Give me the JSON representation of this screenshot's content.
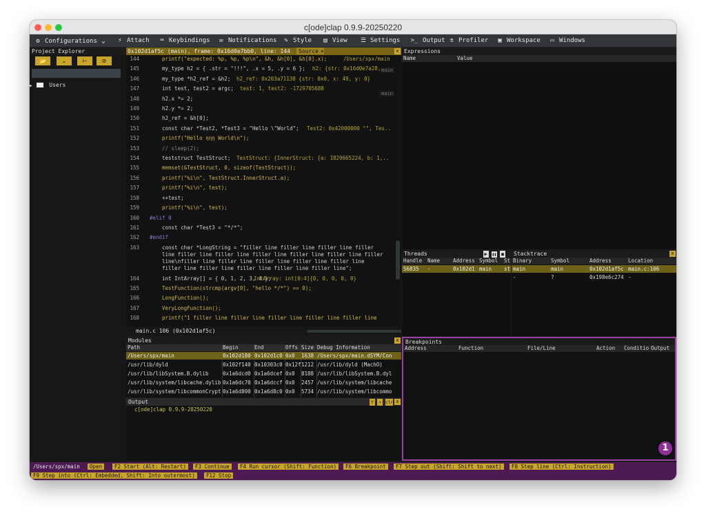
{
  "window": {
    "title": "c[ode]clap 0.9.9-20250220"
  },
  "menu": [
    {
      "label": "Configurations",
      "icon": "gear-icon",
      "glyph": "⚙",
      "dropdown": "⌄"
    },
    {
      "label": "Attach",
      "icon": "plug-icon",
      "glyph": "⚡"
    },
    {
      "label": "Keybindings",
      "icon": "keyboard-icon",
      "glyph": "⌨"
    },
    {
      "label": "Notifications",
      "icon": "chat-icon",
      "glyph": "✉"
    },
    {
      "label": "Style",
      "icon": "pen-icon",
      "glyph": "✎"
    },
    {
      "label": "View",
      "icon": "view-icon",
      "glyph": "▤"
    },
    {
      "label": "Settings",
      "icon": "sliders-icon",
      "glyph": "☰"
    },
    {
      "label": "Output",
      "icon": "terminal-icon",
      "glyph": ">_"
    },
    {
      "label": "Profiler",
      "icon": "flask-icon",
      "glyph": "⚗"
    },
    {
      "label": "Workspace",
      "icon": "workspace-icon",
      "glyph": "▣"
    },
    {
      "label": "Windows",
      "icon": "windows-icon",
      "glyph": "▭"
    }
  ],
  "project_explorer": {
    "title": "Project Explorer",
    "tree_item": "Users",
    "folder_glyph": "▶",
    "buttons": [
      {
        "icon": "open-folder-icon",
        "glyph": "📂"
      },
      {
        "icon": "chevron-down-icon",
        "glyph": "⌄"
      },
      {
        "icon": "tree-icon",
        "glyph": "⊢"
      },
      {
        "icon": "hide-icon",
        "glyph": "⊘"
      }
    ]
  },
  "source": {
    "header": "0x102d1af5c (main), frame: 0x16d0e7bb0, line: 144",
    "dropdown": "Source",
    "dropdown_arrow": "▾",
    "status": "main.c  106 (0x102d1af5c)",
    "lines": [
      {
        "n": "144",
        "code": "printf(\"expected: %p, %p, %p\\n\", &h, &h[0], &h[0].x);",
        "ann": "/Users/spx/main",
        "annx": 315
      },
      {
        "n": "145",
        "code": "my_type h2 = { .str = \"!!!\", .x = 5, .y = 6 };",
        "ann": "h2: {str: 0x16d0e7a28, ..",
        "annx": 270
      },
      {
        "n": "146",
        "code": "my_type *h2_ref = &h2;",
        "ann": "h2_ref: 0x203a71138 {str: 0x0, x: 49, y: 0}",
        "annx": 160
      },
      {
        "n": "147",
        "code": "int test, test2 = argc;",
        "ann": "test: 1, test2: -1729705688",
        "annx": 165
      },
      {
        "n": "148",
        "code": "h2.x *= 2;",
        "ann": "",
        "annx": 0
      },
      {
        "n": "149",
        "code": "h2.y *= 2;",
        "ann": "",
        "annx": 0
      },
      {
        "n": "150",
        "code": "h2_ref = &h[0];",
        "ann": "",
        "annx": 0
      },
      {
        "n": "151",
        "code": "const char *Test2, *Test3 = \"Hello \\\"World\";",
        "ann": "Test2: 0x42000000 \"\", Tes..",
        "annx": 262
      },
      {
        "n": "152",
        "code": "printf(\"Hello ηηη World\\n\");",
        "ann": "",
        "annx": 0
      },
      {
        "n": "153",
        "code": "// sleep(2);",
        "ann": "",
        "annx": 0
      },
      {
        "n": "154",
        "code": "teststruct TestStruct;",
        "ann": "TestStruct: {InnerStruct: {a: 1829665224, b: 1,..",
        "annx": 160
      },
      {
        "n": "155",
        "code": "memset(&TestStruct, 0, sizeof(TestStruct));",
        "ann": "",
        "annx": 0
      },
      {
        "n": "156",
        "code": "printf(\"%i\\n\", TestStruct.InnerStruct.a);",
        "ann": "",
        "annx": 0
      },
      {
        "n": "157",
        "code": "printf(\"%i\\n\", test);",
        "ann": "",
        "annx": 0
      },
      {
        "n": "158",
        "code": "++test;",
        "ann": "",
        "annx": 0
      },
      {
        "n": "159",
        "code": "printf(\"%i\\n\", test);",
        "ann": "",
        "annx": 0
      },
      {
        "n": "160",
        "code": "#elif 0",
        "ann": "",
        "annx": 0
      },
      {
        "n": "161",
        "code": "const char *Test3 = \"*/*\";",
        "ann": "",
        "annx": 0
      },
      {
        "n": "162",
        "code": "#endif",
        "ann": "",
        "annx": 0
      },
      {
        "n": "163",
        "code": "const char *LongString = \"filler line filler line filler line filler",
        "ann": "",
        "annx": 0
      },
      {
        "n": "",
        "code": "line filler line filler line filler line filler line filler line filler",
        "ann": "",
        "annx": 0
      },
      {
        "n": "",
        "code": "line\\nfiller line filler line filler line filler line filler line",
        "ann": "",
        "annx": 0
      },
      {
        "n": "",
        "code": "filler line filler line filler line filler line filler line\";",
        "ann": "",
        "annx": 0
      },
      {
        "n": "164",
        "code": "int IntArray[] = { 0, 1, 2, 3, 4 };",
        "ann": "IntArray: int[0:4]{0, 0, 0, 0, 0}",
        "annx": 185
      },
      {
        "n": "165",
        "code": "TestFunction(strcmp(argv[0], \"hello */*\") == 0);",
        "ann": "",
        "annx": 0
      },
      {
        "n": "166",
        "code": "LongFunction();",
        "ann": "",
        "annx": 0
      },
      {
        "n": "167",
        "code": "VeryLongFunction();",
        "ann": "",
        "annx": 0
      },
      {
        "n": "168",
        "code": "printf(\"1  filler line filler line filler line filler line filler line",
        "ann": "",
        "annx": 0
      }
    ],
    "side_tags": [
      {
        "text": "main",
        "y": 18
      },
      {
        "text": "main",
        "y": 52
      }
    ]
  },
  "expressions": {
    "title": "Expressions",
    "cols": [
      "Name",
      "Value"
    ]
  },
  "threads": {
    "title": "Threads",
    "cols": [
      "Handle",
      "Name",
      "Address",
      "Symbol",
      "St"
    ],
    "rows": [
      [
        "56835",
        "-",
        "0x102d1",
        "main",
        "st"
      ]
    ],
    "controls": [
      "▶",
      "❚❚",
      "■"
    ]
  },
  "stacktrace": {
    "title": "Stacktrace",
    "cols": [
      "Binary",
      "Symbol",
      "Address",
      "Location"
    ],
    "rows": [
      [
        "main",
        "main",
        "0x102d1af5c",
        "main.c:106"
      ],
      [
        "-",
        "?",
        "0x198e6c274",
        "-"
      ]
    ]
  },
  "modules": {
    "title": "Modules",
    "cols": [
      "Path",
      "Begin",
      "End",
      "Offs",
      "Size",
      "Debug Information"
    ],
    "rows": [
      [
        "/Users/spx/main",
        "0x102d180",
        "0x102d1c0",
        "0x0",
        "1638",
        "/Users/spx/main.dSYM/Con"
      ],
      [
        "/usr/lib/dyld",
        "0x102f140",
        "0x10303c0",
        "0x12f",
        "1212",
        "/usr/lib/dyld (MachO)"
      ],
      [
        "/usr/lib/libSystem.B.dylib",
        "0x1a6dcd0",
        "0x1a6dcef",
        "0x0",
        "8188",
        "/usr/lib/libSystem.B.dyl"
      ],
      [
        "/usr/lib/system/libcache.dylib",
        "0x1a6dc70",
        "0x1a6dccf",
        "0x0",
        "2457",
        "/usr/lib/system/libcache"
      ],
      [
        "/usr/lib/system/libcommonCrypt",
        "0x1a6d800",
        "0x1a6d8c0",
        "0x0",
        "5734",
        "/usr/lib/system/libcommo"
      ]
    ]
  },
  "output": {
    "title": "Output",
    "line": "c[ode]clap 0.9.9-20250220",
    "controls": [
      "Y",
      "▾",
      "clr"
    ]
  },
  "breakpoints": {
    "title": "Breakpoints",
    "cols": [
      "Address",
      "Function",
      "File/Line",
      "Action",
      "Conditio",
      "Output"
    ],
    "badge": "1",
    "highlight": "#9b3fa3"
  },
  "statusbar": {
    "path": "/Users/spx/main",
    "items": [
      "Open",
      "F2 Start (Alt: Restart)",
      "F3 Continue",
      "F4 Run cursor (Shift: Function)",
      "F6 Breakpoint",
      "F7 Step out (Shift: Shift to next)",
      "F8 Step line (Ctrl: Instruction)",
      "F9 Step into (Ctrl: Embedded, Shift: Into outermost)",
      "F12 Stop"
    ]
  },
  "colors": {
    "accent": "#c9a62a",
    "selection": "#6e6218",
    "status": "#4d1a54"
  }
}
